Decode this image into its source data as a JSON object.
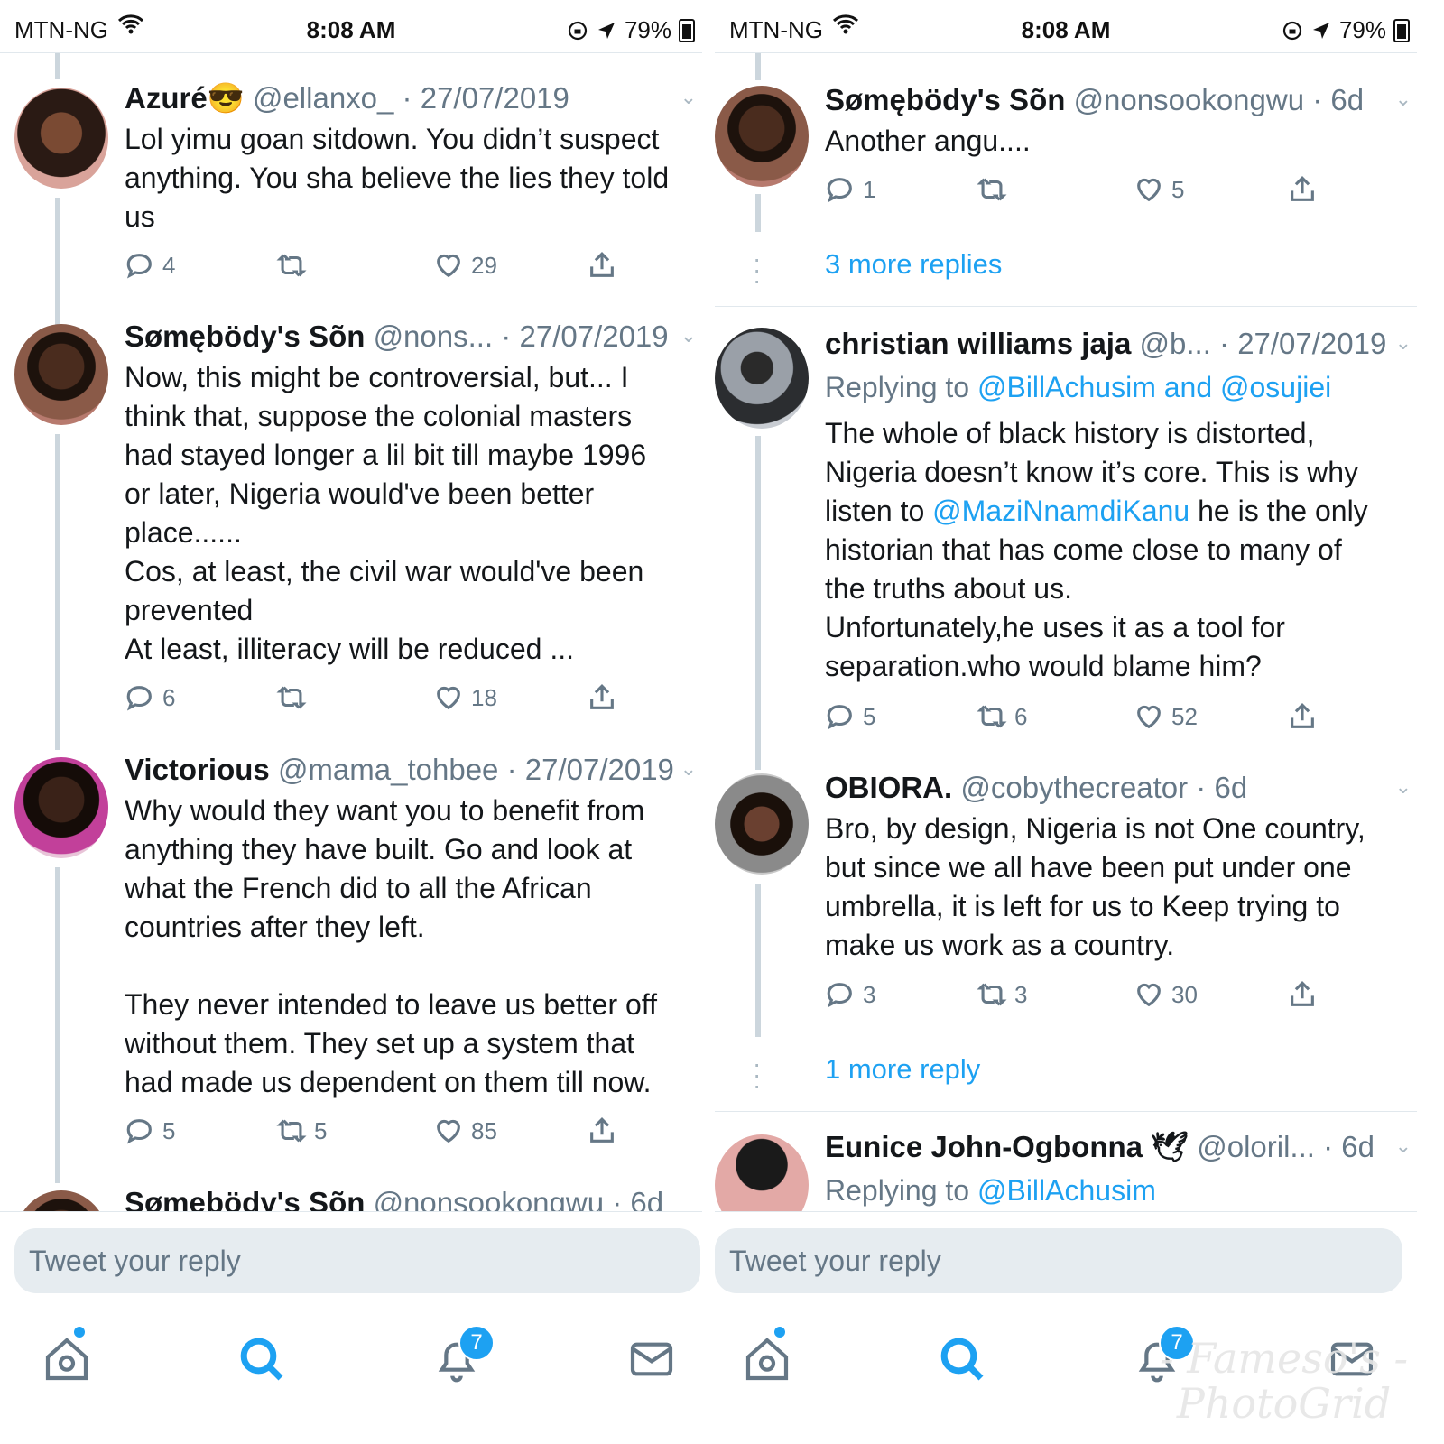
{
  "status_bar": {
    "carrier": "MTN-NG",
    "time": "8:08 AM",
    "battery": "79%"
  },
  "left": {
    "tweets": [
      {
        "name": "Azuré😎",
        "handle": "@ellanxo_",
        "date": "27/07/2019",
        "text": "Lol yimu goan sitdown. You didn’t suspect\nanything. You sha believe the lies they told\nus",
        "replies": "4",
        "retweets": "",
        "likes": "29"
      },
      {
        "name": "Sømębödy's Sõn",
        "handle": "@nons...",
        "date": "27/07/2019",
        "text": "Now, this might be controversial, but... I\nthink that, suppose the colonial masters\nhad stayed longer a lil bit till maybe 1996\nor later,  Nigeria would've been better\nplace......\nCos, at least, the civil war would've been\nprevented\nAt least, illiteracy will be reduced ...",
        "replies": "6",
        "retweets": "",
        "likes": "18"
      },
      {
        "name": "Victorious",
        "handle": "@mama_tohbee",
        "date": "27/07/2019",
        "text": "Why would they want you to benefit from\nanything they have built. Go and look at\nwhat the French did to all the African\ncountries after they left.\n\nThey never intended to leave us better off\nwithout them. They set up a system that\nhad made us dependent on them till now.",
        "replies": "5",
        "retweets": "5",
        "likes": "85"
      },
      {
        "name": "Sømębödy's Sõn",
        "handle": "@nonsookongwu",
        "date": "6d"
      }
    ],
    "compose_placeholder": "Tweet your reply",
    "notif_count": "7"
  },
  "right": {
    "tweets": [
      {
        "name": "Sømębödy's Sõn",
        "handle": "@nonsookongwu",
        "date": "6d",
        "text": "Another angu....",
        "replies": "1",
        "retweets": "",
        "likes": "5"
      },
      {
        "name": "christian williams jaja",
        "handle": "@b...",
        "date": "27/07/2019",
        "replying_prefix": "Replying to",
        "replying_to": "@BillAchusim and @osujiei",
        "text_1": "The whole of black history is distorted,\nNigeria doesn’t know it’s core. This is why\nlisten to ",
        "mention": "@MaziNnamdiKanu",
        "text_2": " he is the only\nhistorian that has come close to many of\nthe truths about us.\nUnfortunately,he uses it as a tool for\nseparation.who would blame him?",
        "replies": "5",
        "retweets": "6",
        "likes": "52"
      },
      {
        "name": "OBIORA.",
        "handle": "@cobythecreator",
        "date": "6d",
        "text": "Bro, by design, Nigeria is not One country,\nbut since we all have been put under one\numbrella, it is left for us to Keep trying to\nmake us work as a country.",
        "replies": "3",
        "retweets": "3",
        "likes": "30"
      },
      {
        "name": "Eunice John-Ogbonna 🕊",
        "handle": "@oloril...",
        "date": "6d",
        "replying_prefix": "Replying to",
        "replying_to": "@BillAchusim"
      }
    ],
    "more_replies_1": "3 more replies",
    "more_replies_2": "1 more reply",
    "compose_placeholder": "Tweet your reply",
    "notif_count": "7",
    "watermark_1": "- Fameso's -",
    "watermark_2": "PhotoGrid"
  },
  "colors": {
    "accent": "#1da1f2",
    "muted": "#657786",
    "thread": "#ccd6dd"
  },
  "icons": [
    "reply-icon",
    "retweet-icon",
    "like-icon",
    "share-icon",
    "home-icon",
    "search-icon",
    "bell-icon",
    "mail-icon",
    "wifi-icon",
    "location-icon",
    "orientation-lock-icon"
  ]
}
